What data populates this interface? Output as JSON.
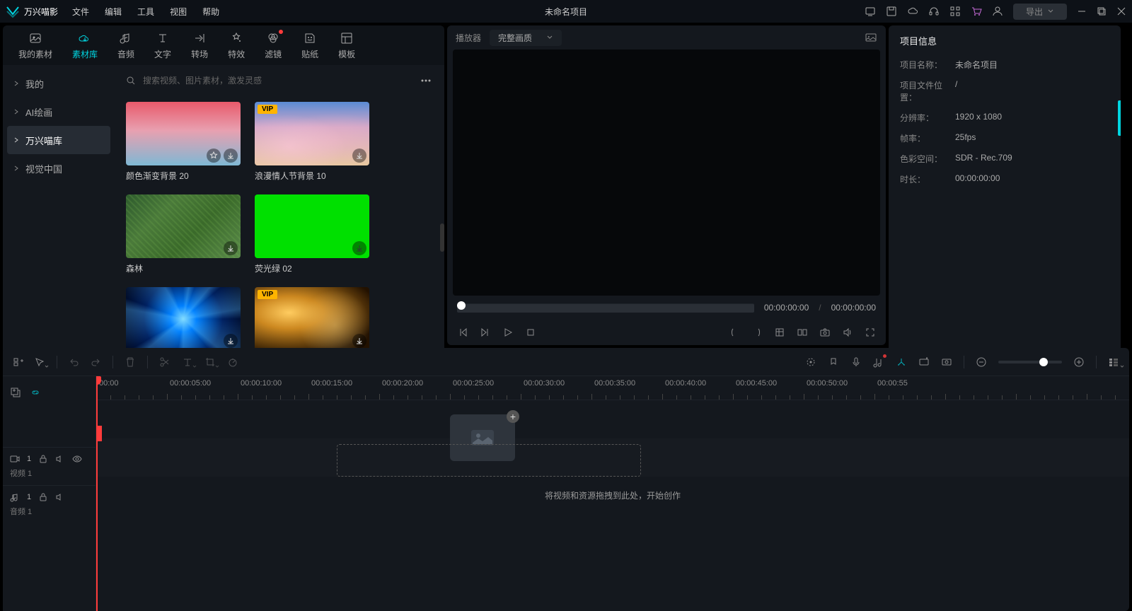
{
  "titlebar": {
    "brand": "万兴喵影",
    "menu": [
      "文件",
      "编辑",
      "工具",
      "视图",
      "帮助"
    ],
    "project_title": "未命名项目",
    "export_label": "导出"
  },
  "tabs": [
    {
      "label": "我的素材"
    },
    {
      "label": "素材库",
      "active": true
    },
    {
      "label": "音频"
    },
    {
      "label": "文字"
    },
    {
      "label": "转场"
    },
    {
      "label": "特效"
    },
    {
      "label": "滤镜",
      "dot": true
    },
    {
      "label": "贴纸"
    },
    {
      "label": "模板"
    }
  ],
  "sidebar": {
    "items": [
      {
        "label": "我的"
      },
      {
        "label": "AI绘画"
      },
      {
        "label": "万兴喵库",
        "active": true
      },
      {
        "label": "视觉中国"
      }
    ]
  },
  "search": {
    "placeholder": "搜索视频、图片素材，激发灵感"
  },
  "cards": [
    {
      "label": "颜色渐变背景 20",
      "thumb": "gradient",
      "fav": true
    },
    {
      "label": "浪漫情人节背景 10",
      "thumb": "sky",
      "vip": true
    },
    {
      "label": "森林",
      "thumb": "forest"
    },
    {
      "label": "荧光绿 02",
      "thumb": "green"
    },
    {
      "label": "",
      "thumb": "flare"
    },
    {
      "label": "",
      "thumb": "gold",
      "vip": true
    }
  ],
  "player": {
    "label": "播放器",
    "quality": "完整画质",
    "current": "00:00:00:00",
    "total": "00:00:00:00"
  },
  "timeline": {
    "labels": [
      "00:00",
      "00:00:05:00",
      "00:00:10:00",
      "00:00:15:00",
      "00:00:20:00",
      "00:00:25:00",
      "00:00:30:00",
      "00:00:35:00",
      "00:00:40:00",
      "00:00:45:00",
      "00:00:50:00",
      "00:00:55"
    ],
    "video_track": {
      "badge": "1",
      "name": "视频 1"
    },
    "audio_track": {
      "badge": "1",
      "name": "音频 1"
    },
    "hint": "将视频和资源拖拽到此处，开始创作"
  },
  "panel": {
    "title": "项目信息",
    "rows": [
      {
        "k": "项目名称：",
        "v": "未命名项目"
      },
      {
        "k": "项目文件位置：",
        "v": "/"
      },
      {
        "k": "分辨率：",
        "v": "1920 x 1080"
      },
      {
        "k": "帧率：",
        "v": "25fps"
      },
      {
        "k": "色彩空间：",
        "v": "SDR - Rec.709"
      },
      {
        "k": "时长：",
        "v": "00:00:00:00"
      }
    ]
  }
}
